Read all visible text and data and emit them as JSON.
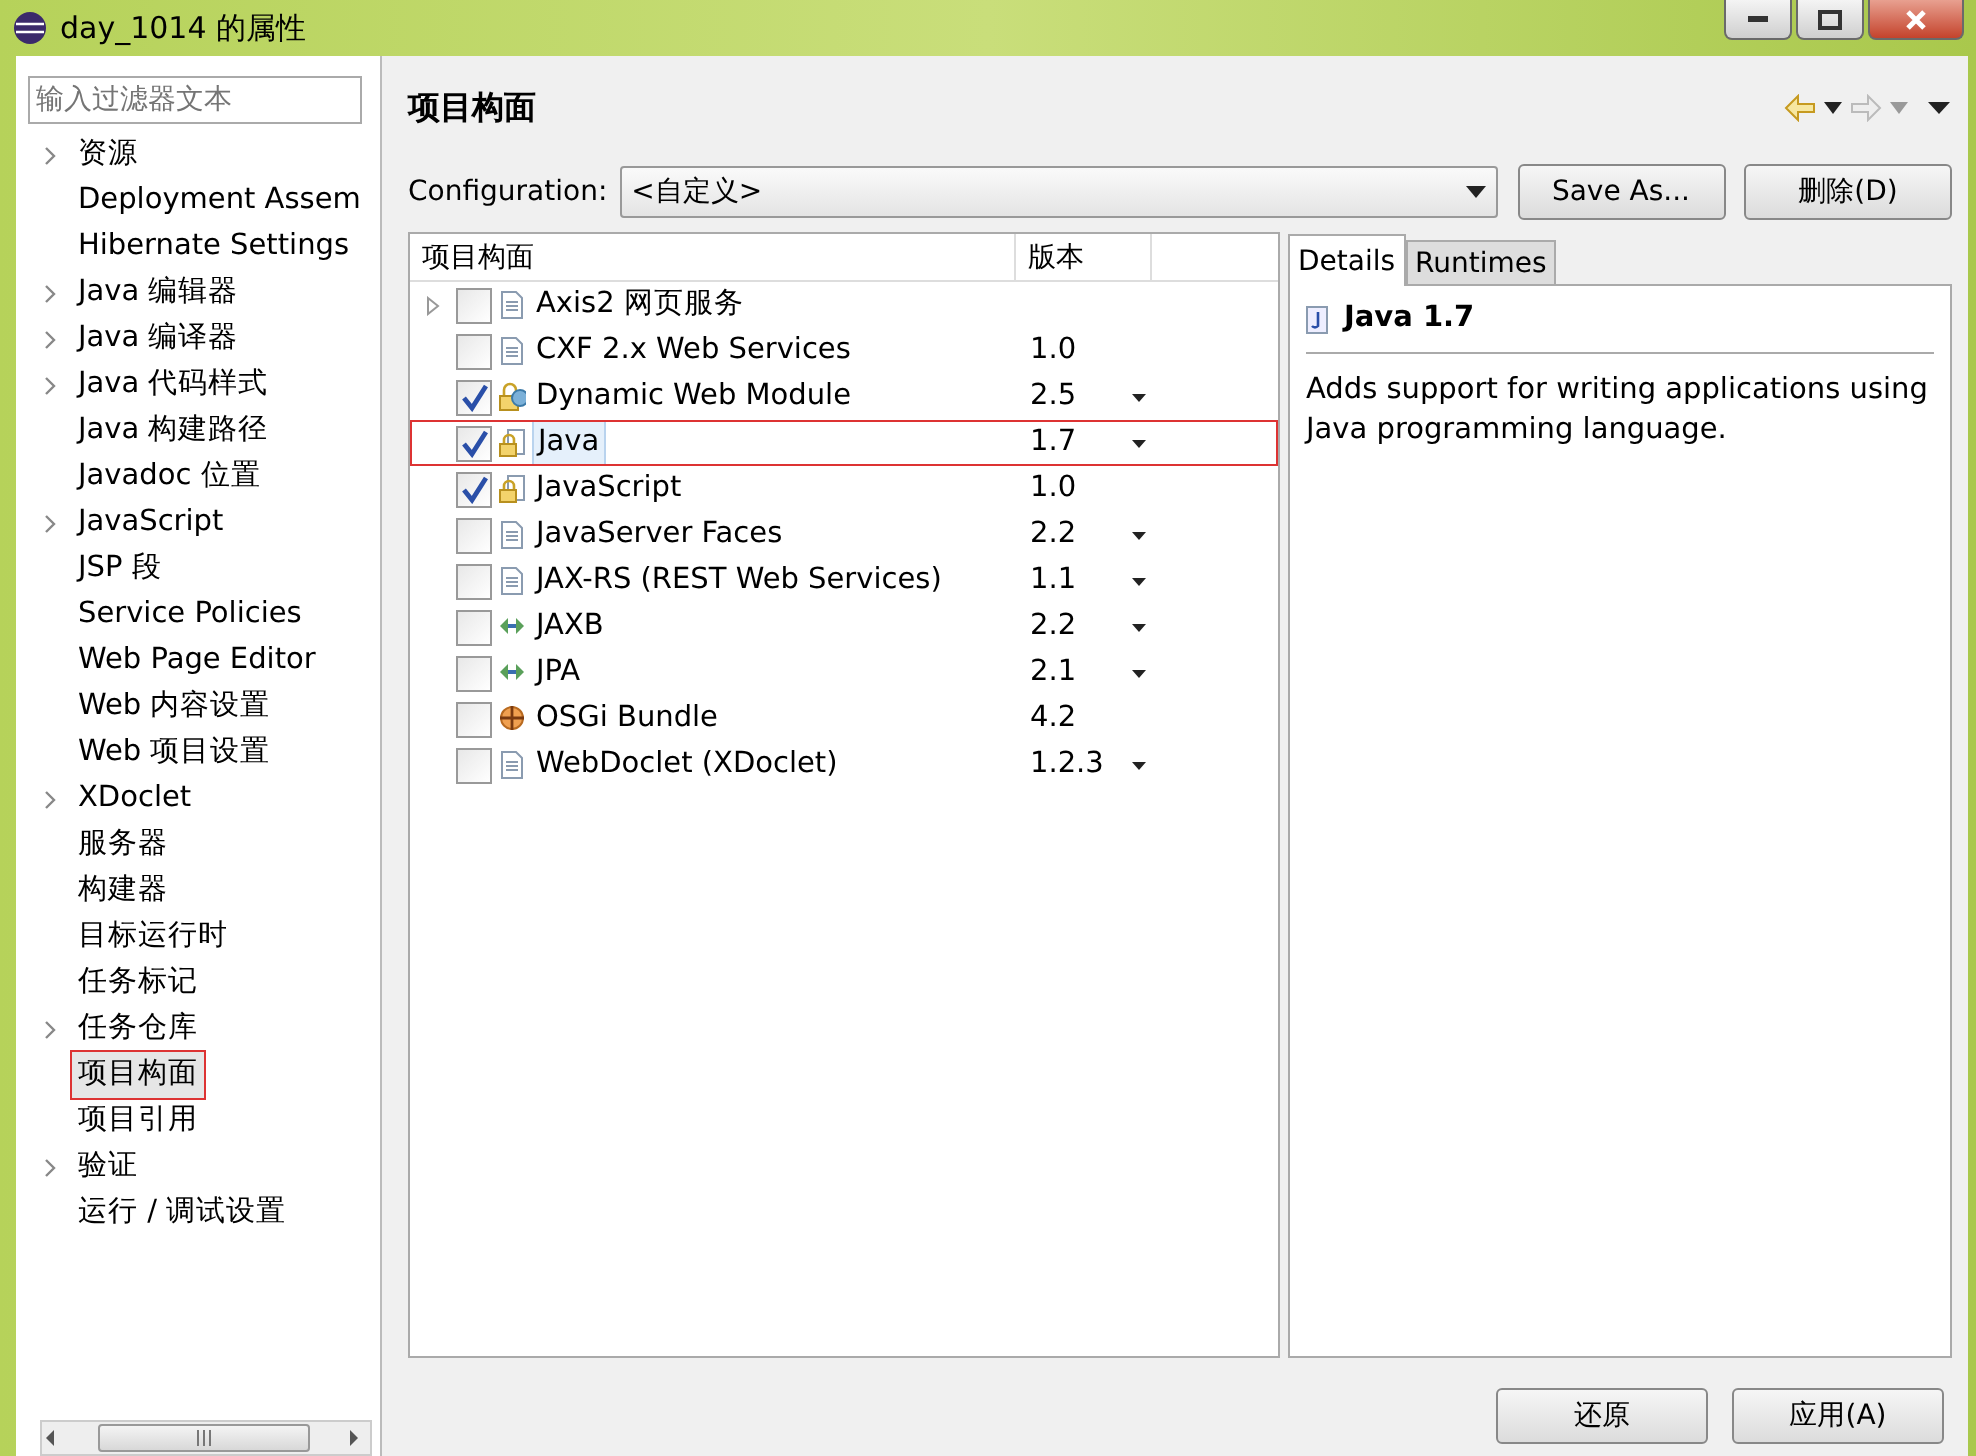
{
  "window": {
    "title": "day_1014 的属性"
  },
  "filter": {
    "placeholder": "输入过滤器文本"
  },
  "sidebar": {
    "items": [
      {
        "label": "资源",
        "expandable": true,
        "selected": false,
        "highlighted": false
      },
      {
        "label": "Deployment Assem",
        "expandable": false,
        "selected": false,
        "highlighted": false
      },
      {
        "label": "Hibernate Settings",
        "expandable": false,
        "selected": false,
        "highlighted": false
      },
      {
        "label": "Java 编辑器",
        "expandable": true,
        "selected": false,
        "highlighted": false
      },
      {
        "label": "Java 编译器",
        "expandable": true,
        "selected": false,
        "highlighted": false
      },
      {
        "label": "Java 代码样式",
        "expandable": true,
        "selected": false,
        "highlighted": false
      },
      {
        "label": "Java 构建路径",
        "expandable": false,
        "selected": false,
        "highlighted": false
      },
      {
        "label": "Javadoc 位置",
        "expandable": false,
        "selected": false,
        "highlighted": false
      },
      {
        "label": "JavaScript",
        "expandable": true,
        "selected": false,
        "highlighted": false
      },
      {
        "label": "JSP 段",
        "expandable": false,
        "selected": false,
        "highlighted": false
      },
      {
        "label": "Service Policies",
        "expandable": false,
        "selected": false,
        "highlighted": false
      },
      {
        "label": "Web Page Editor",
        "expandable": false,
        "selected": false,
        "highlighted": false
      },
      {
        "label": "Web 内容设置",
        "expandable": false,
        "selected": false,
        "highlighted": false
      },
      {
        "label": "Web 项目设置",
        "expandable": false,
        "selected": false,
        "highlighted": false
      },
      {
        "label": "XDoclet",
        "expandable": true,
        "selected": false,
        "highlighted": false
      },
      {
        "label": "服务器",
        "expandable": false,
        "selected": false,
        "highlighted": false
      },
      {
        "label": "构建器",
        "expandable": false,
        "selected": false,
        "highlighted": false
      },
      {
        "label": "目标运行时",
        "expandable": false,
        "selected": false,
        "highlighted": false
      },
      {
        "label": "任务标记",
        "expandable": false,
        "selected": false,
        "highlighted": false
      },
      {
        "label": "任务仓库",
        "expandable": true,
        "selected": false,
        "highlighted": false
      },
      {
        "label": "项目构面",
        "expandable": false,
        "selected": true,
        "highlighted": true
      },
      {
        "label": "项目引用",
        "expandable": false,
        "selected": false,
        "highlighted": false
      },
      {
        "label": "验证",
        "expandable": true,
        "selected": false,
        "highlighted": false
      },
      {
        "label": "运行 / 调试设置",
        "expandable": false,
        "selected": false,
        "highlighted": false
      }
    ]
  },
  "page": {
    "title": "项目构面"
  },
  "configuration": {
    "label": "Configuration:",
    "value": "<自定义>",
    "buttons": [
      "Save As...",
      "删除(D)"
    ]
  },
  "facets": {
    "columns": [
      "项目构面",
      "版本"
    ],
    "rows": [
      {
        "name": "Axis2 网页服务",
        "version": "",
        "kind": "document",
        "checked": false,
        "expandable": true,
        "version_menu": false,
        "selected": false,
        "highlighted": false
      },
      {
        "name": "CXF 2.x Web Services",
        "version": "1.0",
        "kind": "document",
        "checked": false,
        "expandable": false,
        "version_menu": false,
        "selected": false,
        "highlighted": false
      },
      {
        "name": "Dynamic Web Module",
        "version": "2.5",
        "kind": "module",
        "checked": true,
        "expandable": false,
        "version_menu": true,
        "selected": false,
        "highlighted": false
      },
      {
        "name": "Java",
        "version": "1.7",
        "kind": "locked",
        "checked": true,
        "expandable": false,
        "version_menu": true,
        "selected": true,
        "highlighted": true
      },
      {
        "name": "JavaScript",
        "version": "1.0",
        "kind": "locked",
        "checked": true,
        "expandable": false,
        "version_menu": false,
        "selected": false,
        "highlighted": false
      },
      {
        "name": "JavaServer Faces",
        "version": "2.2",
        "kind": "document",
        "checked": false,
        "expandable": false,
        "version_menu": true,
        "selected": false,
        "highlighted": false
      },
      {
        "name": "JAX-RS (REST Web Services)",
        "version": "1.1",
        "kind": "document",
        "checked": false,
        "expandable": false,
        "version_menu": true,
        "selected": false,
        "highlighted": false
      },
      {
        "name": "JAXB",
        "version": "2.2",
        "kind": "binding",
        "checked": false,
        "expandable": false,
        "version_menu": true,
        "selected": false,
        "highlighted": false
      },
      {
        "name": "JPA",
        "version": "2.1",
        "kind": "binding",
        "checked": false,
        "expandable": false,
        "version_menu": true,
        "selected": false,
        "highlighted": false
      },
      {
        "name": "OSGi Bundle",
        "version": "4.2",
        "kind": "bundle",
        "checked": false,
        "expandable": false,
        "version_menu": false,
        "selected": false,
        "highlighted": false
      },
      {
        "name": "WebDoclet (XDoclet)",
        "version": "1.2.3",
        "kind": "document",
        "checked": false,
        "expandable": false,
        "version_menu": true,
        "selected": false,
        "highlighted": false
      }
    ]
  },
  "details": {
    "tabs": [
      {
        "label": "Details",
        "selected": true
      },
      {
        "label": "Runtimes",
        "selected": false
      }
    ],
    "title": "Java 1.7",
    "description": "Adds support for writing applications using Java programming language."
  },
  "footer": {
    "buttons": [
      "还原",
      "应用(A)"
    ]
  }
}
